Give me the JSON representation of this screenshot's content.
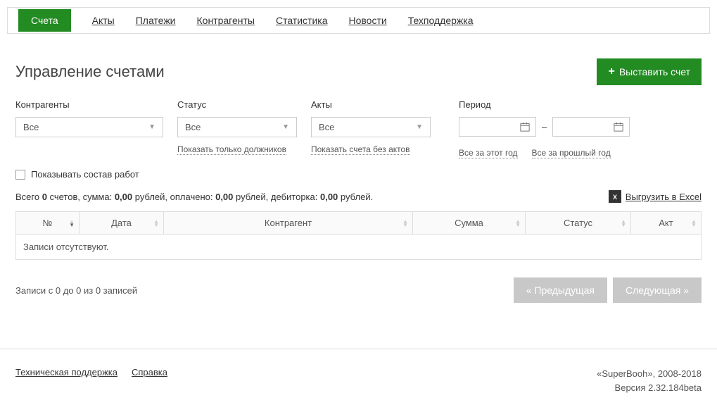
{
  "nav": {
    "tabs": [
      "Счета",
      "Акты",
      "Платежи",
      "Контрагенты",
      "Статистика",
      "Новости",
      "Техподдержка"
    ],
    "active": 0
  },
  "page_title": "Управление счетами",
  "create_button": "Выставить счет",
  "filters": {
    "contragents": {
      "label": "Контрагенты",
      "value": "Все"
    },
    "status": {
      "label": "Статус",
      "value": "Все",
      "sublink": "Показать только должников"
    },
    "acts": {
      "label": "Акты",
      "value": "Все",
      "sublink": "Показать счета без актов"
    },
    "period": {
      "label": "Период",
      "dash": "–",
      "link_this_year": "Все за этот год",
      "link_last_year": "Все за прошлый год"
    }
  },
  "show_works_checkbox": "Показывать состав работ",
  "summary": {
    "text_1": "Всего ",
    "count": "0",
    "text_2": " счетов, сумма: ",
    "sum": "0,00",
    "text_3": " рублей, оплачено: ",
    "paid": "0,00",
    "text_4": " рублей, дебиторка: ",
    "debt": "0,00",
    "text_5": " рублей."
  },
  "excel_link": "Выгрузить в Excel",
  "table": {
    "headers": [
      "№",
      "Дата",
      "Контрагент",
      "Сумма",
      "Статус",
      "Акт"
    ],
    "empty_text": "Записи отсутствуют."
  },
  "pagination": {
    "info": "Записи с 0 до 0 из 0 записей",
    "prev": "« Предыдущая",
    "next": "Следующая »"
  },
  "footer": {
    "tech_support": "Техническая поддержка",
    "help": "Справка",
    "brand": "«SuperBooh», 2008-2018",
    "version": "Версия 2.32.184beta"
  }
}
